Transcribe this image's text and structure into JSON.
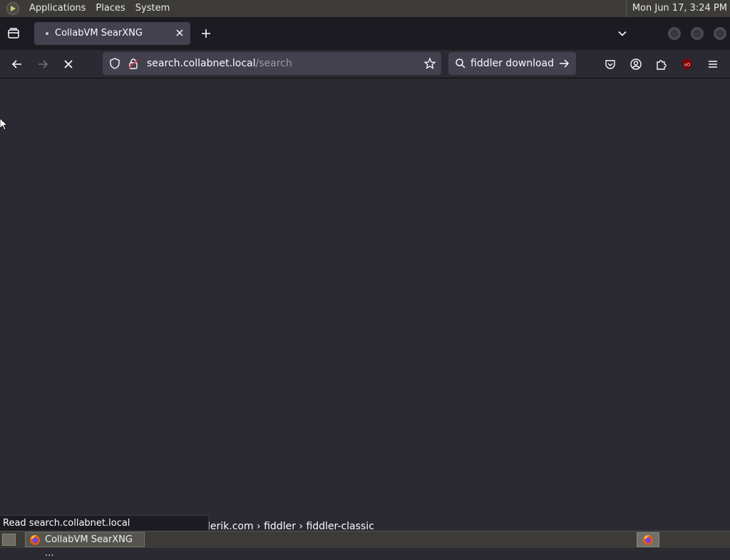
{
  "top_panel": {
    "menus": [
      "Applications",
      "Places",
      "System"
    ],
    "clock": "Mon Jun 17,  3:24 PM"
  },
  "tab": {
    "title": "CollabVM SearXNG"
  },
  "navbar": {
    "url_host": "search.collabnet.local",
    "url_path": "/search",
    "search_query": "fiddler download"
  },
  "content": {
    "peek_link": "lerik.com  › fiddler › fiddler-classic",
    "status_text": "Read search.collabnet.local"
  },
  "taskbar": {
    "task_label": "CollabVM SearXNG ..."
  },
  "colors": {
    "toolbar_bg": "#2b2a33",
    "tabstrip_bg": "#1c1b22",
    "field_bg": "#42414d",
    "ublock_red": "#800000"
  }
}
